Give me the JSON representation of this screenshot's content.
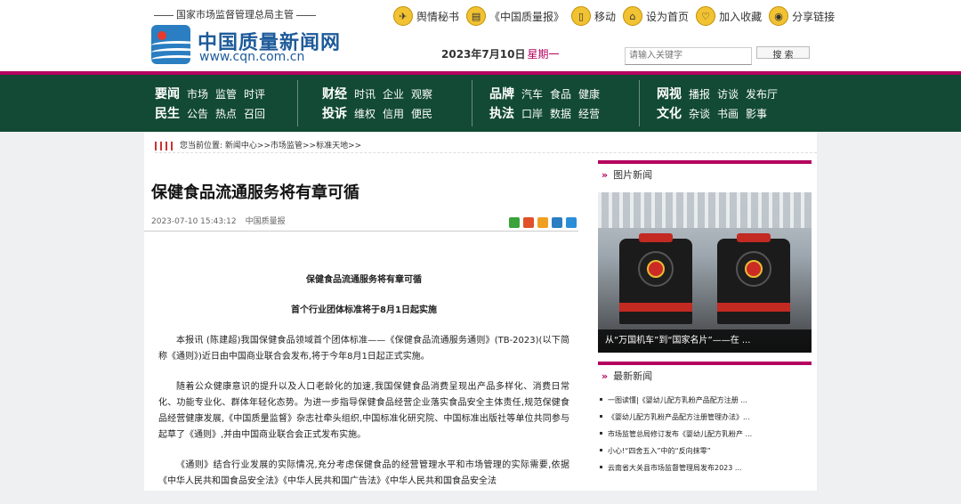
{
  "header": {
    "slogan": "国家市场监督管理总局主管",
    "logo_cn": "中国质量新闻网",
    "logo_en": "www.cqn.com.cn",
    "links": [
      {
        "label": "舆情秘书",
        "icon": "megaphone-icon",
        "glyph": "✈"
      },
      {
        "label": "《中国质量报》",
        "icon": "newspaper-icon",
        "glyph": "▤"
      },
      {
        "label": "移动",
        "icon": "mobile-icon",
        "glyph": "▯"
      },
      {
        "label": "设为首页",
        "icon": "home-icon",
        "glyph": "⌂"
      },
      {
        "label": "加入收藏",
        "icon": "heart-icon",
        "glyph": "♡"
      },
      {
        "label": "分享链接",
        "icon": "rss-icon",
        "glyph": "◉"
      }
    ],
    "date": "2023年7月10日",
    "weekday": "星期一",
    "search_placeholder": "请输入关键字",
    "search_button": "搜 索"
  },
  "nav": {
    "groups": [
      {
        "rows": [
          {
            "head": "要闻",
            "items": [
              "市场",
              "监管",
              "时评"
            ]
          },
          {
            "head": "民生",
            "items": [
              "公告",
              "热点",
              "召回"
            ]
          }
        ]
      },
      {
        "rows": [
          {
            "head": "财经",
            "items": [
              "时讯",
              "企业",
              "观察"
            ]
          },
          {
            "head": "投诉",
            "items": [
              "维权",
              "信用",
              "便民"
            ]
          }
        ]
      },
      {
        "rows": [
          {
            "head": "品牌",
            "items": [
              "汽车",
              "食品",
              "健康"
            ]
          },
          {
            "head": "执法",
            "items": [
              "口岸",
              "数据",
              "经营"
            ]
          }
        ]
      },
      {
        "rows": [
          {
            "head": "网视",
            "items": [
              "播报",
              "访谈",
              "发布厅"
            ]
          },
          {
            "head": "文化",
            "items": [
              "杂谈",
              "书画",
              "影事"
            ]
          }
        ]
      }
    ]
  },
  "breadcrumb": {
    "prefix": "您当前位置:",
    "path": "新闻中心>>市场监管>>标准天地>>"
  },
  "article": {
    "title": "保健食品流通服务将有章可循",
    "datetime": "2023-07-10 15:43:12",
    "source": "中国质量报",
    "sub_title": "保健食品流通服务将有章可循",
    "sub_title2": "首个行业团体标准将于8月1日起实施",
    "paragraphs": [
      "本报讯 (陈建超)我国保健食品领域首个团体标准——《保健食品流通服务通则》(TB-2023)(以下简称《通则》)近日由中国商业联合会发布,将于今年8月1日起正式实施。",
      "随着公众健康意识的提升以及人口老龄化的加速,我国保健食品消费呈现出产品多样化、消费日常化、功能专业化、群体年轻化态势。为进一步指导保健食品经营企业落实食品安全主体责任,规范保健食品经营健康发展,《中国质量监督》杂志社牵头组织,中国标准化研究院、中国标准出版社等单位共同参与起草了《通则》,并由中国商业联合会正式发布实施。",
      "《通则》结合行业发展的实际情况,充分考虑保健食品的经营管理水平和市场管理的实际需要,依据《中华人民共和国食品安全法》《中华人民共和国广告法》《中华人民共和国食品安全法"
    ],
    "share_colors": [
      "#3aa33a",
      "#e0502a",
      "#f0a020",
      "#2a7ec1",
      "#2a8fd8"
    ]
  },
  "sidebar": {
    "photo_title": "图片新闻",
    "photo_caption": "从“万国机车”到“国家名片”——在 ...",
    "latest_title": "最新新闻",
    "latest": [
      "一图读懂|《婴幼儿配方乳粉产品配方注册 ...",
      "《婴幼儿配方乳粉产品配方注册管理办法》...",
      "市场监管总局修订发布《婴幼儿配方乳粉产 ...",
      "小心!“四舍五入”中的“反向抹零”",
      "云南省大关县市场监督管理局发布2023 ..."
    ]
  }
}
